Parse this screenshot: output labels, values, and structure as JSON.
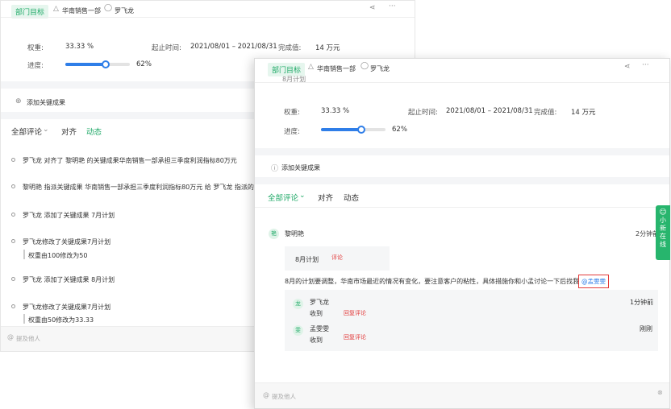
{
  "back": {
    "header": {
      "tag": "部门目标",
      "dept": "华南销售一部",
      "user": "罗飞龙"
    },
    "weight_label": "权重:",
    "weight_value": "33.33 %",
    "period_label": "起止时间:",
    "period_value": "2021/08/01 – 2021/08/31",
    "completion_label": "完成值:",
    "completion_value": "14 万元",
    "progress_label": "进度:",
    "progress_value": 0.62,
    "progress_text": "62%",
    "add_kr": "添加关键成果",
    "tabs": [
      "全部评论",
      "对齐",
      "动态"
    ],
    "activity": [
      {
        "text": "罗飞龙 对齐了 黎明艳 的关键成果华南销售一部承担三季度利润指标80万元"
      },
      {
        "text": "黎明艳 指派关键成果 华南销售一部承担三季度利润指标80万元 给 罗飞龙 指派的"
      },
      {
        "text": "罗飞龙 添加了关键成果 7月计划"
      },
      {
        "text": "罗飞龙修改了关键成果7月计划",
        "sub": "权重由100修改为50"
      },
      {
        "text": "罗飞龙 添加了关键成果 8月计划"
      },
      {
        "text": "罗飞龙修改了关键成果7月计划",
        "sub": "权重由50修改为33.33"
      }
    ],
    "mention_placeholder": "提及他人"
  },
  "front": {
    "header": {
      "tag": "部门目标",
      "dept": "华南销售一部",
      "user": "罗飞龙"
    },
    "cut_title": "8月计划",
    "weight_label": "权重:",
    "weight_value": "33.33 %",
    "period_label": "起止时间:",
    "period_value": "2021/08/01 – 2021/08/31",
    "completion_label": "完成值:",
    "completion_value": "14 万元",
    "progress_label": "进度:",
    "progress_value": 0.62,
    "progress_text": "62%",
    "add_kr": "添加关键成果",
    "tabs": [
      "全部评论",
      "对齐",
      "动态"
    ],
    "comment": {
      "avatar": "艳",
      "author": "黎明艳",
      "time": "2分钟前",
      "kr_name": "8月计划",
      "kr_note": "评论",
      "body": "8月的计划要调整，华南市场最近的情况有变化，要注意客户的粘性，具体措施你和小孟讨论一下后找我",
      "mention": "@孟雯雯",
      "replies": [
        {
          "avatar": "龙",
          "name": "罗飞龙",
          "action": "收到",
          "note": "回复评论",
          "time": "1分钟前"
        },
        {
          "avatar": "雯",
          "name": "孟雯雯",
          "action": "收到",
          "note": "回复评论",
          "time": "刚刚"
        }
      ]
    },
    "mention_placeholder": "提及他人"
  },
  "side_widget": "小新在线",
  "colors": {
    "accent_green": "#1fa967",
    "accent_blue": "#2f7ee8",
    "alert_red": "#e23a3a"
  }
}
